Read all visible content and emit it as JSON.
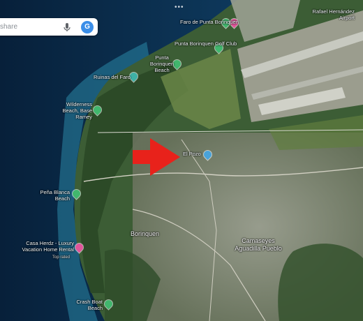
{
  "search": {
    "placeholder": "share",
    "mic_icon": "mic-icon",
    "avatar_letter": "G"
  },
  "top_handle": "•••",
  "places": {
    "faro": "Faro de Punta Borinquen",
    "golf_club": "Punta Borinquen Golf Club",
    "punta_beach": "Punta Borinquen Beach",
    "ruinas": "Ruinas del Faro",
    "wilderness": "Wilderness Beach, Base Ramey",
    "pena_blanca": "Peña Blanca Beach",
    "casa_herdz": "Casa Herdz - Luxury Vacation Home Rental",
    "top_rated": "Top rated",
    "crash_boat": "Crash Boat Beach",
    "borinquen": "Borinquen",
    "camaseyes": "Camaseyes Aguadilla Pueblo",
    "airport": "Rafael Hernández Airport",
    "el_pozo": "El Pozo"
  },
  "marker": {
    "type": "red-arrow",
    "color": "#e8221b"
  },
  "colors": {
    "sea": "#0c2e4a",
    "land": "#3a5a34",
    "urban": "#8d8f86"
  }
}
